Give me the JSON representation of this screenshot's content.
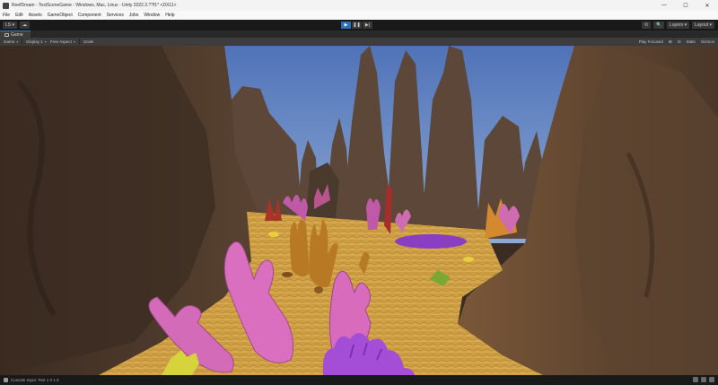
{
  "window": {
    "title": "ReefDream - TestSceneGame - Windows, Mac, Linux - Unity 2022.3.??f1* <DX11>",
    "controls": [
      "—",
      "☐",
      "✕"
    ]
  },
  "menu": [
    "File",
    "Edit",
    "Assets",
    "GameObject",
    "Component",
    "Services",
    "Jobs",
    "Window",
    "Help"
  ],
  "toolbar": {
    "account_label": "LS ▾",
    "cloud_label": "☁",
    "play_buttons": [
      "▶",
      "❚❚",
      "▶|"
    ],
    "right_buttons": [
      "⟲",
      "🔍",
      "Layers ▾",
      "Layout ▾"
    ]
  },
  "tabs": [
    {
      "label": "Game",
      "icon": "game-tab-icon"
    }
  ],
  "game_bar": {
    "mode_label": "Game",
    "display_label": "Display 1",
    "aspect_label": "Free Aspect",
    "scale_label": "Scale",
    "play_focus_label": "Play Focused",
    "right_items": [
      "⊞",
      "⊡",
      "Stats",
      "Gizmos"
    ]
  },
  "status": {
    "text": "Console Input: Test 1 0 1 0"
  },
  "colors": {
    "sky": "#6f8fc8",
    "sand": "#d4a64a",
    "rock": "#5b4332",
    "coral_pink": "#d968b4",
    "coral_purple": "#a246d4",
    "coral_orange": "#c88128",
    "accent_blue": "#3a79bb"
  }
}
